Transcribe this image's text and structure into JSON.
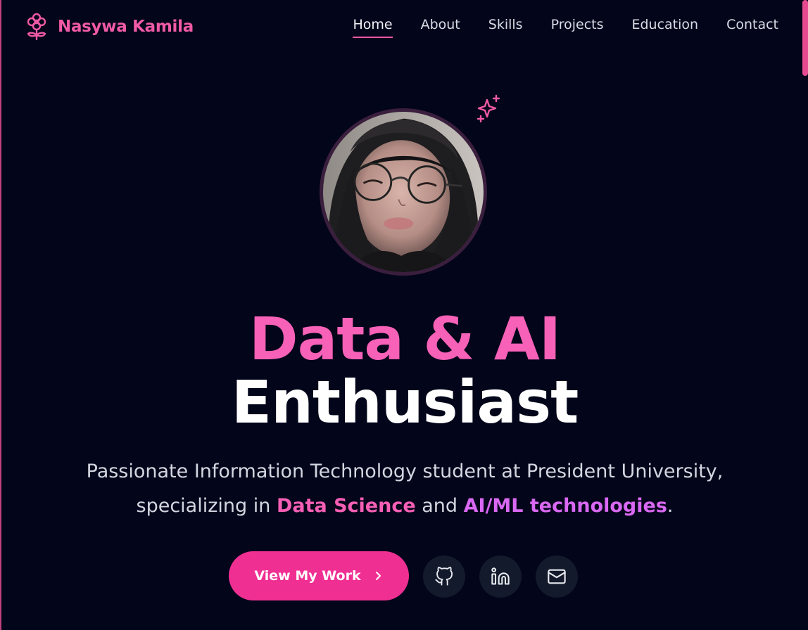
{
  "brand": {
    "name": "Nasywa Kamila",
    "icon": "flower-icon"
  },
  "nav": {
    "items": [
      {
        "label": "Home",
        "active": true
      },
      {
        "label": "About",
        "active": false
      },
      {
        "label": "Skills",
        "active": false
      },
      {
        "label": "Projects",
        "active": false
      },
      {
        "label": "Education",
        "active": false
      },
      {
        "label": "Contact",
        "active": false
      }
    ]
  },
  "hero": {
    "headline_line1": "Data & AI",
    "headline_line2": "Enthusiast",
    "tagline_part1": "Passionate Information Technology student at President University, specializing in ",
    "tagline_highlight1": "Data Science",
    "tagline_part2": " and ",
    "tagline_highlight2": "AI/ML technologies",
    "tagline_part3": ".",
    "cta_label": "View My Work",
    "cta_icon": "chevron-right-icon",
    "socials": [
      {
        "name": "github",
        "icon": "github-icon"
      },
      {
        "name": "linkedin",
        "icon": "linkedin-icon"
      },
      {
        "name": "email",
        "icon": "mail-icon"
      }
    ]
  },
  "colors": {
    "background": "#03051a",
    "accent_pink": "#f761b7",
    "accent_violet": "#d968f2",
    "button": "#f02f93",
    "social_bg": "#131a2b"
  }
}
